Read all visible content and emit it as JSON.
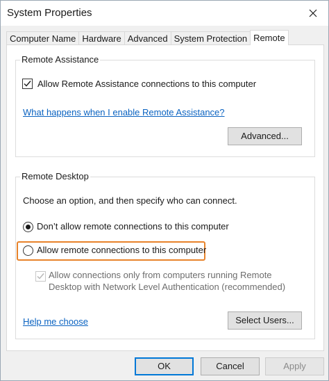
{
  "window": {
    "title": "System Properties"
  },
  "tabs": [
    {
      "label": "Computer Name"
    },
    {
      "label": "Hardware"
    },
    {
      "label": "Advanced"
    },
    {
      "label": "System Protection"
    },
    {
      "label": "Remote",
      "active": true
    }
  ],
  "remote_assistance": {
    "legend": "Remote Assistance",
    "allow_label": "Allow Remote Assistance connections to this computer",
    "allow_checked": true,
    "help_link": "What happens when I enable Remote Assistance?",
    "advanced_button": "Advanced..."
  },
  "remote_desktop": {
    "legend": "Remote Desktop",
    "instruction": "Choose an option, and then specify who can connect.",
    "option_dont_allow": "Don’t allow remote connections to this computer",
    "option_allow": "Allow remote connections to this computer",
    "selected_option": "dont_allow",
    "nla_line1": "Allow connections only from computers running Remote",
    "nla_line2": "Desktop with Network Level Authentication (recommended)",
    "nla_checked": true,
    "nla_enabled": false,
    "help_link": "Help me choose",
    "select_users_button": "Select Users..."
  },
  "footer": {
    "ok": "OK",
    "cancel": "Cancel",
    "apply": "Apply"
  },
  "colors": {
    "highlight": "#e8832a",
    "link": "#0b63c1",
    "default_button_border": "#0078d7"
  }
}
